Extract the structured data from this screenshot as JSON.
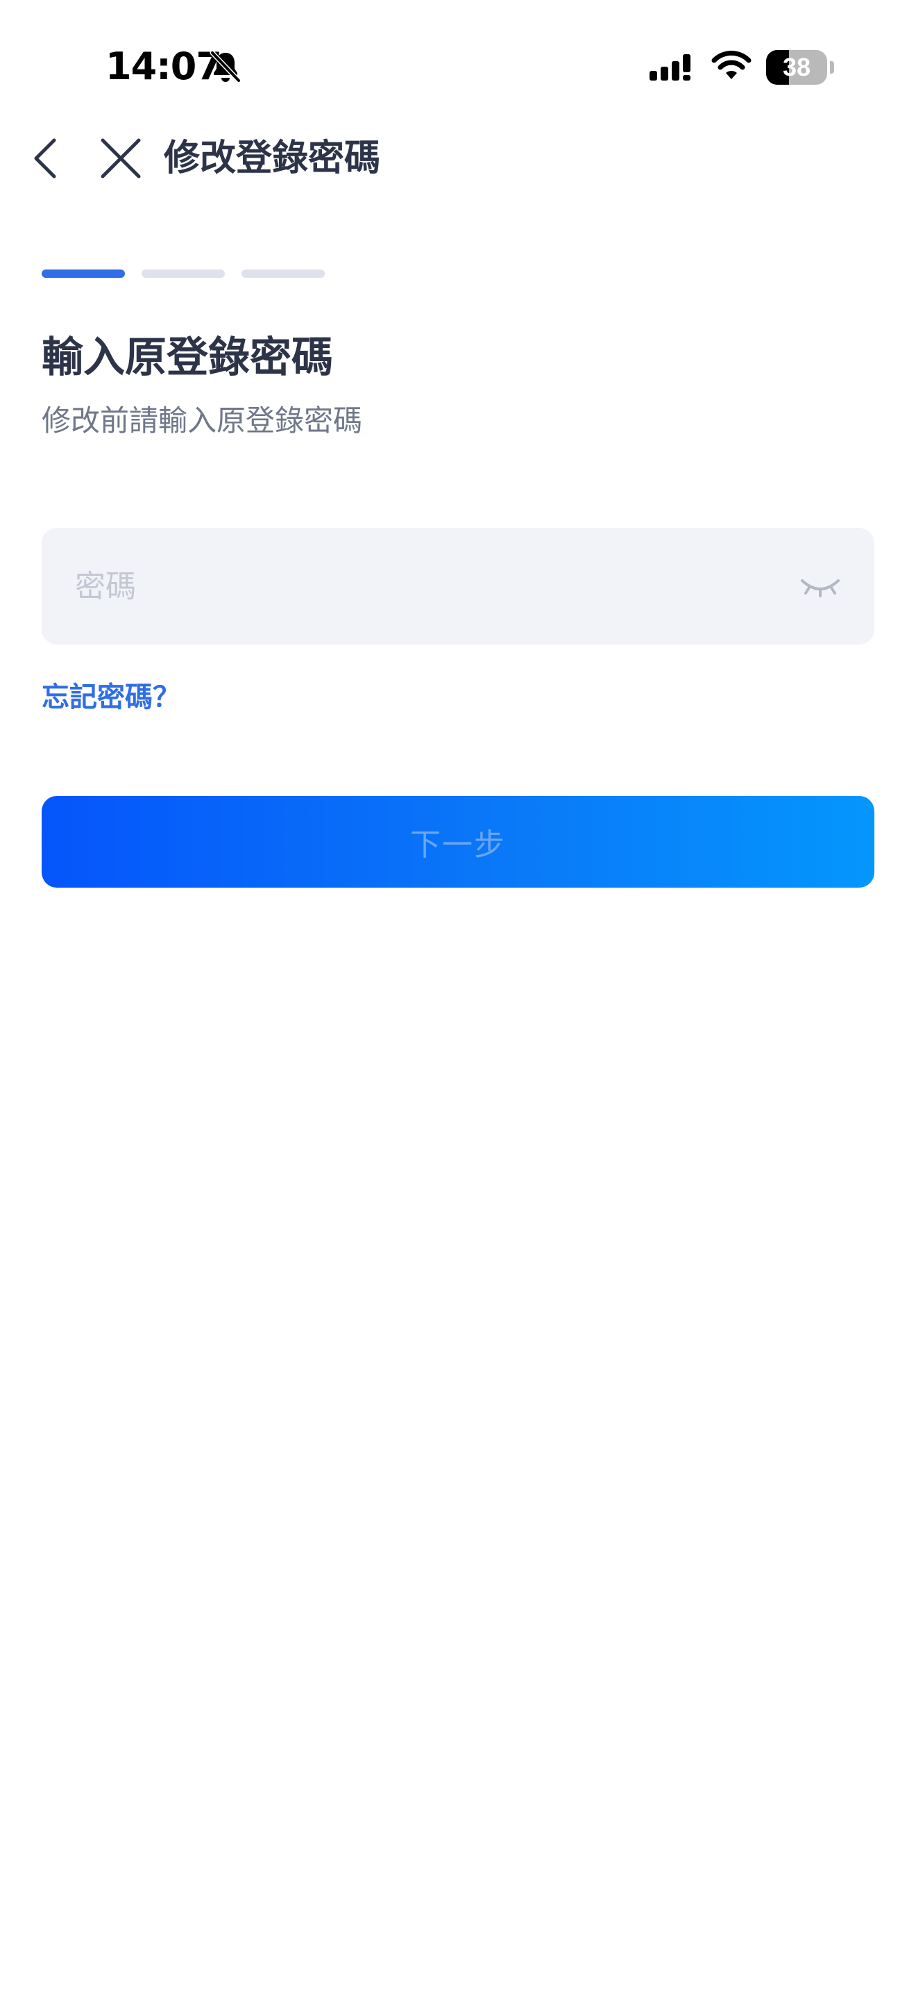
{
  "status_bar": {
    "time": "14:07",
    "battery_level": "38",
    "battery_fraction": 0.38,
    "icons": [
      "bell-off-icon",
      "cellular-signal-icon",
      "wifi-icon",
      "battery-icon"
    ]
  },
  "nav": {
    "back_icon": "chevron-left-icon",
    "close_icon": "close-icon",
    "title": "修改登錄密碼"
  },
  "steps": {
    "total": 3,
    "current": 1,
    "active_color": "#2f6ee6",
    "inactive_color": "#dfe2ea"
  },
  "content": {
    "heading": "輸入原登錄密碼",
    "subheading": "修改前請輸入原登錄密碼"
  },
  "password_field": {
    "placeholder": "密碼",
    "value": "",
    "toggle_icon": "eye-closed-icon"
  },
  "forgot_link": "忘記密碼？",
  "next_button": {
    "label": "下一步",
    "gradient_start": "#0555fb",
    "gradient_end": "#0496fd"
  },
  "colors": {
    "accent": "#2f6ee6",
    "title_text": "#2d3348",
    "secondary_text": "#70778a",
    "field_background": "#f2f3f8"
  }
}
